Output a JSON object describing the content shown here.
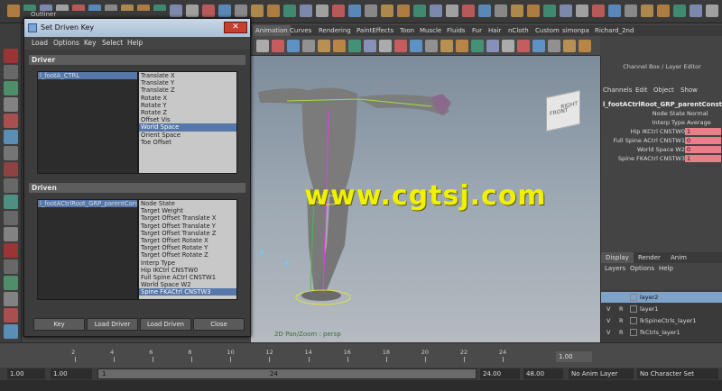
{
  "colors": {
    "accent": "#5577aa",
    "watermark": "#f0f000",
    "channel_highlight": "#e8808a",
    "dialog_titlebar": "#b9cbe0"
  },
  "outliner": {
    "tab_label": "Outliner"
  },
  "shelf": {
    "tabs": [
      "Animation",
      "Curves",
      "Rendering",
      "PaintEffects",
      "Toon",
      "Muscle",
      "Fluids",
      "Fur",
      "Hair",
      "nCloth",
      "Custom",
      "simonpa",
      "Richard_2nd"
    ],
    "active_tab": "Animation"
  },
  "viewport": {
    "label": "2D Pan/Zoom : persp",
    "viewcube": {
      "front": "FRONT",
      "right": "RIGHT"
    },
    "watermark": "www.cgtsj.com"
  },
  "dialog": {
    "title": "Set Driven Key",
    "close_label": "✕",
    "menu": [
      "Load",
      "Options",
      "Key",
      "Select",
      "Help"
    ],
    "driver": {
      "header": "Driver",
      "objects": [
        "l_footA_CTRL"
      ],
      "selected_object": "l_footA_CTRL",
      "attributes": [
        "Translate X",
        "Translate Y",
        "Translate Z",
        "Rotate X",
        "Rotate Y",
        "Rotate Z",
        "Offset Vis",
        "World Space",
        "Orient Space",
        "Toe Offset"
      ],
      "selected_attribute": "World Space"
    },
    "driven": {
      "header": "Driven",
      "objects": [
        "l_footACtrlRoot_GRP_parentConstr"
      ],
      "selected_object": "l_footACtrlRoot_GRP_parentConstr",
      "attributes": [
        "Node State",
        "Target Weight",
        "Target Offset Translate X",
        "Target Offset Translate Y",
        "Target Offset Translate Z",
        "Target Offset Rotate X",
        "Target Offset Rotate Y",
        "Target Offset Rotate Z",
        "Interp Type",
        "Hip IKCtrl CNSTW0",
        "Full Spine ACtrl CNSTW1",
        "World Space W2",
        "Spine FKACtrl CNSTW3"
      ],
      "selected_attribute": "Spine FKACtrl CNSTW3"
    },
    "buttons": {
      "key": "Key",
      "load_driver": "Load Driver",
      "load_driven": "Load Driven",
      "close": "Close"
    }
  },
  "channel_box": {
    "title": "Channel Box / Layer Editor",
    "menu": [
      "Channels",
      "Edit",
      "Object",
      "Show"
    ],
    "object_name": "l_footACtrlRoot_GRP_parentConstr...",
    "channels": [
      {
        "label": "Node State",
        "value": "Normal",
        "highlight": false
      },
      {
        "label": "Interp Type",
        "value": "Average",
        "highlight": false
      },
      {
        "label": "Hip IKCtrl CNSTW0",
        "value": "1",
        "highlight": true
      },
      {
        "label": "Full Spine ACtrl CNSTW1",
        "value": "0",
        "highlight": true
      },
      {
        "label": "World Space W2",
        "value": "0",
        "highlight": true
      },
      {
        "label": "Spine FKACtrl CNSTW3",
        "value": "1",
        "highlight": true
      }
    ],
    "layer_tabs": [
      "Display",
      "Render",
      "Anim"
    ],
    "active_layer_tab": "Display",
    "layer_menu": [
      "Layers",
      "Options",
      "Help"
    ],
    "layers": [
      {
        "v": "",
        "r": "",
        "name": "layer2",
        "selected": true
      },
      {
        "v": "V",
        "r": "R",
        "name": "layer1",
        "selected": false
      },
      {
        "v": "V",
        "r": "R",
        "name": "lkSpineCtrls_layer1",
        "selected": false
      },
      {
        "v": "V",
        "r": "R",
        "name": "fkCtrls_layer1",
        "selected": false
      }
    ]
  },
  "timeline": {
    "ticks": [
      "2",
      "4",
      "6",
      "8",
      "10",
      "12",
      "14",
      "16",
      "18",
      "20",
      "22",
      "24"
    ],
    "current_frame": "1.00"
  },
  "range": {
    "start": "1.00",
    "playback_start": "1.00",
    "slider_start": "1",
    "slider_end": "24",
    "playback_end": "24.00",
    "end": "48.00",
    "anim_layer": "No Anim Layer",
    "character_set": "No Character Set"
  }
}
